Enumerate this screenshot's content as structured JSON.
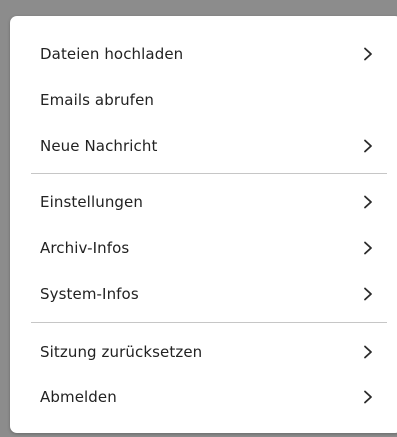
{
  "menu": {
    "groups": [
      {
        "items": [
          {
            "label": "Dateien hochladen",
            "has_submenu": true
          },
          {
            "label": "Emails abrufen",
            "has_submenu": false
          },
          {
            "label": "Neue Nachricht",
            "has_submenu": true
          }
        ]
      },
      {
        "items": [
          {
            "label": "Einstellungen",
            "has_submenu": true
          },
          {
            "label": "Archiv-Infos",
            "has_submenu": true
          },
          {
            "label": "System-Infos",
            "has_submenu": true
          }
        ]
      },
      {
        "items": [
          {
            "label": "Sitzung zurücksetzen",
            "has_submenu": true
          },
          {
            "label": "Abmelden",
            "has_submenu": true
          }
        ]
      }
    ],
    "icons": {
      "submenu": "chevron-right-icon"
    }
  }
}
